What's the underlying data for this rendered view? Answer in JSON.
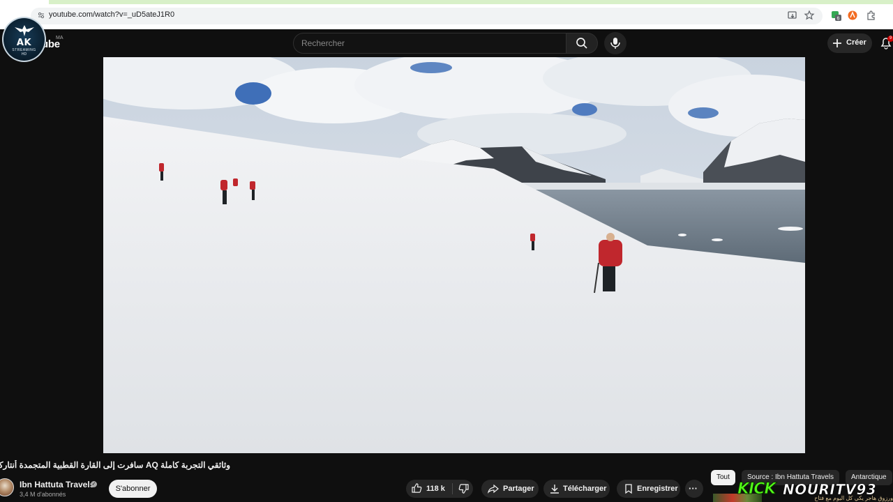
{
  "browser": {
    "url": "youtube.com/watch?v=_uD5ateJ1R0",
    "extension_badge": "6"
  },
  "overlay_logo": {
    "text": "AK",
    "sub1": "STREAMING",
    "sub2": "HD"
  },
  "header": {
    "logo_partial": "ube",
    "country": "MA",
    "search_placeholder": "Rechercher",
    "create_label": "Créer",
    "notification_count": "9"
  },
  "video": {
    "title": "وثائقي التجربة كاملة AQ سافرت إلى القارة القطبية المتجمدة أنتاركتيكا",
    "channel_name": "Ibn Hattuta Travels",
    "subscribers": "3,4 M d'abonnés",
    "subscribe_label": "S'abonner"
  },
  "actions": {
    "likes": "118 k",
    "share_label": "Partager",
    "download_label": "Télécharger",
    "save_label": "Enregistrer",
    "more_label": "···"
  },
  "chips": [
    {
      "label": "Tout",
      "active": true
    },
    {
      "label": "Source : Ibn Hattuta Travels",
      "active": false
    },
    {
      "label": "Antarctique",
      "active": false
    }
  ],
  "stream_overlay": {
    "kick": "KICK",
    "name": "NOURITV93",
    "ticker": "ورزوق هاجر يكي كل اليوم مع فتاح"
  },
  "colors": {
    "background": "#0f0f0f",
    "kick_green": "#53fc18",
    "chip_active": "#f1f1f1"
  }
}
